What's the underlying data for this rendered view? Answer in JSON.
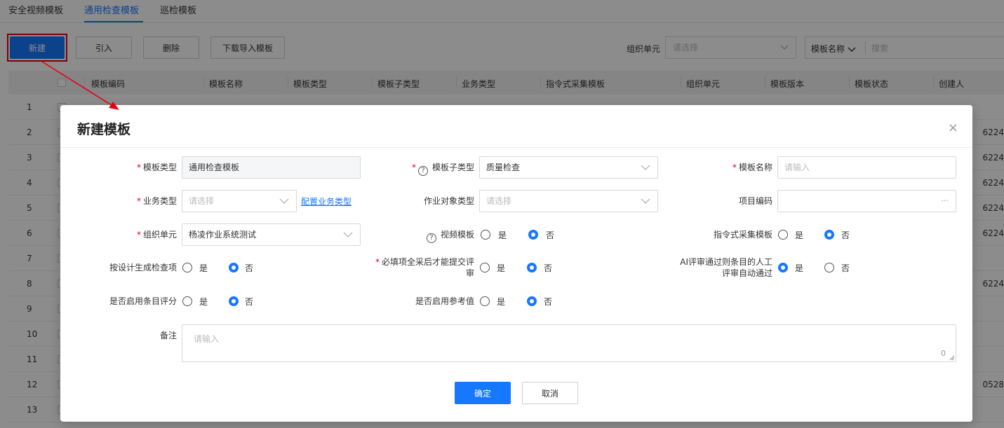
{
  "tabs": [
    {
      "label": "安全视频模板"
    },
    {
      "label": "通用检查模板"
    },
    {
      "label": "巡检模板"
    }
  ],
  "toolbar": {
    "new_label": "新建",
    "import_label": "引入",
    "delete_label": "删除",
    "download_label": "下载导入模板"
  },
  "filter": {
    "org_label": "组织单元",
    "org_placeholder": "请选择",
    "search_field": "模板名称",
    "search_placeholder": "搜索"
  },
  "table": {
    "columns": [
      "模板编码",
      "模板名称",
      "模板类型",
      "模板子类型",
      "业务类型",
      "指令式采集模板",
      "组织单元",
      "模板版本",
      "模板状态",
      "创建人"
    ],
    "rows": [
      {
        "num": "1",
        "creator": ""
      },
      {
        "num": "2",
        "creator": "6224"
      },
      {
        "num": "3",
        "creator": "6224"
      },
      {
        "num": "4",
        "creator": "6224"
      },
      {
        "num": "5",
        "creator": "6224"
      },
      {
        "num": "6",
        "creator": "6224"
      },
      {
        "num": "7",
        "creator": ""
      },
      {
        "num": "8",
        "creator": "6224"
      },
      {
        "num": "9",
        "creator": ""
      },
      {
        "num": "10",
        "creator": ""
      },
      {
        "num": "11",
        "creator": ""
      },
      {
        "num": "12",
        "creator": "0528"
      },
      {
        "num": "13",
        "creator": ""
      }
    ]
  },
  "modal": {
    "title": "新建模板",
    "close": "×",
    "fields": {
      "template_type": {
        "label": "模板类型",
        "value": "通用检查模板"
      },
      "template_subtype": {
        "label": "模板子类型",
        "value": "质量检查"
      },
      "template_name": {
        "label": "模板名称",
        "placeholder": "请输入"
      },
      "business_type": {
        "label": "业务类型",
        "placeholder": "请选择",
        "link": "配置业务类型"
      },
      "work_object_type": {
        "label": "作业对象类型",
        "placeholder": "请选择"
      },
      "project_code": {
        "label": "项目编码",
        "dots": "···"
      },
      "org_unit": {
        "label": "组织单元",
        "value": "杨凌作业系统测试"
      },
      "video_template": {
        "label": "视频模板"
      },
      "cmd_template": {
        "label": "指令式采集模板"
      },
      "design_generate": {
        "label": "按设计生成检查项"
      },
      "required_submit": {
        "label_line1": "必填项全采后才能提交评",
        "label_line2": "审"
      },
      "ai_review": {
        "label_line1": "AI评审通过则条目的人工",
        "label_line2": "评审自动通过"
      },
      "item_score": {
        "label": "是否启用条目评分"
      },
      "ref_value": {
        "label": "是否启用参考值"
      },
      "remark": {
        "label": "备注",
        "placeholder": "请输入",
        "count": "0"
      }
    },
    "radio_yes": "是",
    "radio_no": "否",
    "ok_label": "确定",
    "cancel_label": "取消"
  },
  "colors": {
    "accent": "#1677ff",
    "highlight": "#e60012"
  }
}
